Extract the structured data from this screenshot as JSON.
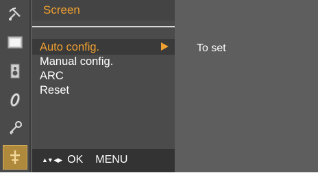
{
  "menu": {
    "title": "Screen",
    "items": [
      {
        "label": "Auto config.",
        "selected": true
      },
      {
        "label": "Manual config.",
        "selected": false
      },
      {
        "label": "ARC",
        "selected": false
      },
      {
        "label": "Reset",
        "selected": false
      }
    ]
  },
  "info": {
    "text": "To set"
  },
  "footer": {
    "nav_glyph": "▲▼  ◀▶",
    "ok_label": "OK",
    "menu_label": "MENU"
  },
  "icons": [
    {
      "name": "satellite-icon",
      "active": false
    },
    {
      "name": "screen-icon",
      "active": false
    },
    {
      "name": "speaker-icon",
      "active": false
    },
    {
      "name": "time-icon",
      "active": false
    },
    {
      "name": "key-icon",
      "active": false
    },
    {
      "name": "tools-icon",
      "active": true
    }
  ],
  "colors": {
    "highlight": "#f0a030",
    "text": "#ffffff",
    "panel": "#4b4b4b",
    "background": "#5e5e5e"
  }
}
